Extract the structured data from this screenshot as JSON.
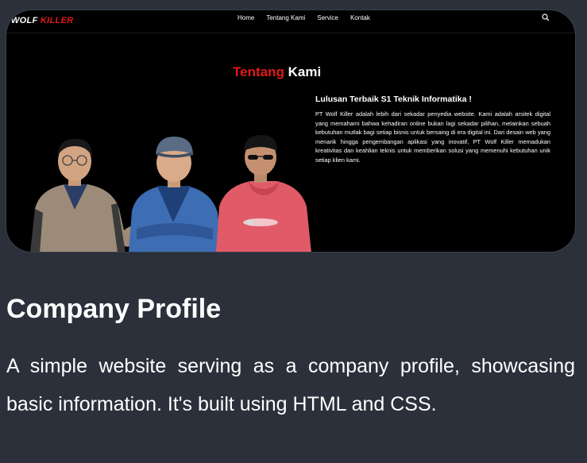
{
  "colors": {
    "accent": "#e11919",
    "page_bg": "#2b303b",
    "card_bg": "#000000"
  },
  "preview": {
    "logo": {
      "part1": "WOLF",
      "part2": "KILLER"
    },
    "nav": [
      "Home",
      "Tentang Kami",
      "Service",
      "Kontak"
    ],
    "search_icon": "search-icon",
    "section_title": {
      "accent": "Tentang",
      "rest": "Kami"
    },
    "subtitle": "Lulusan Terbaik S1 Teknik Informatika !",
    "paragraph": "PT Wolf Killer adalah lebih dari sekadar penyedia website. Kami adalah arsitek digital yang memahami bahwa kehadiran online bukan lagi sekadar pilihan, melainkan sebuah kebutuhan mutlak bagi setiap bisnis untuk bersaing di era digital ini. Dari desain web yang menarik hingga pengembangan aplikasi yang inovatif, PT Wolf Killer memadukan kreativitas dan keahlian teknis untuk memberikan solusi yang memenuhi kebutuhan unik setiap klien kami."
  },
  "project": {
    "title": "Company Profile",
    "description": "A simple website serving as a company profile, showcasing basic information. It's built using HTML and CSS."
  }
}
